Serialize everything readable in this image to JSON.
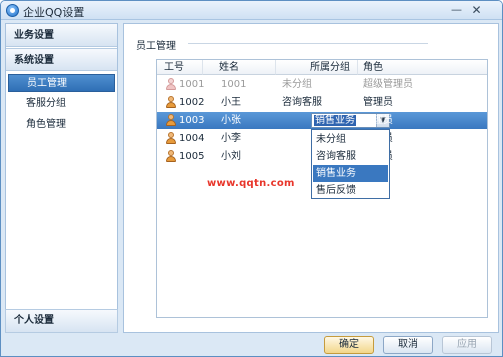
{
  "window": {
    "title": "企业QQ设置",
    "minimize_label": "—",
    "close_label": "✕"
  },
  "sidebar": {
    "categories": [
      {
        "label": "业务设置"
      },
      {
        "label": "系统设置"
      }
    ],
    "items": [
      {
        "label": "员工管理",
        "selected": true
      },
      {
        "label": "客服分组",
        "selected": false
      },
      {
        "label": "角色管理",
        "selected": false
      }
    ],
    "bottom_category": "个人设置"
  },
  "main": {
    "group_title": "员工管理",
    "table": {
      "headers": [
        "工号",
        "姓名",
        "所属分组",
        "角色"
      ],
      "rows": [
        {
          "id": "1001",
          "name": "1001",
          "group": "未分组",
          "role": "超级管理员",
          "disabled": true,
          "selected": false
        },
        {
          "id": "1002",
          "name": "小王",
          "group": "咨询客服",
          "role": "管理员",
          "disabled": false,
          "selected": false
        },
        {
          "id": "1003",
          "name": "小张",
          "group": "销售业务",
          "role": "管理员",
          "disabled": false,
          "selected": true
        },
        {
          "id": "1004",
          "name": "小李",
          "group": "",
          "role": "管理员",
          "disabled": false,
          "selected": false
        },
        {
          "id": "1005",
          "name": "小刘",
          "group": "",
          "role": "管理员",
          "disabled": false,
          "selected": false
        }
      ],
      "combo": {
        "value": "销售业务",
        "arrow": "▼",
        "options": [
          "未分组",
          "咨询客服",
          "销售业务",
          "售后反馈"
        ],
        "highlighted": "销售业务"
      }
    }
  },
  "watermark": "www.qqtn.com",
  "footer": {
    "ok_label": "确定",
    "cancel_label": "取消",
    "apply_label": "应用"
  }
}
